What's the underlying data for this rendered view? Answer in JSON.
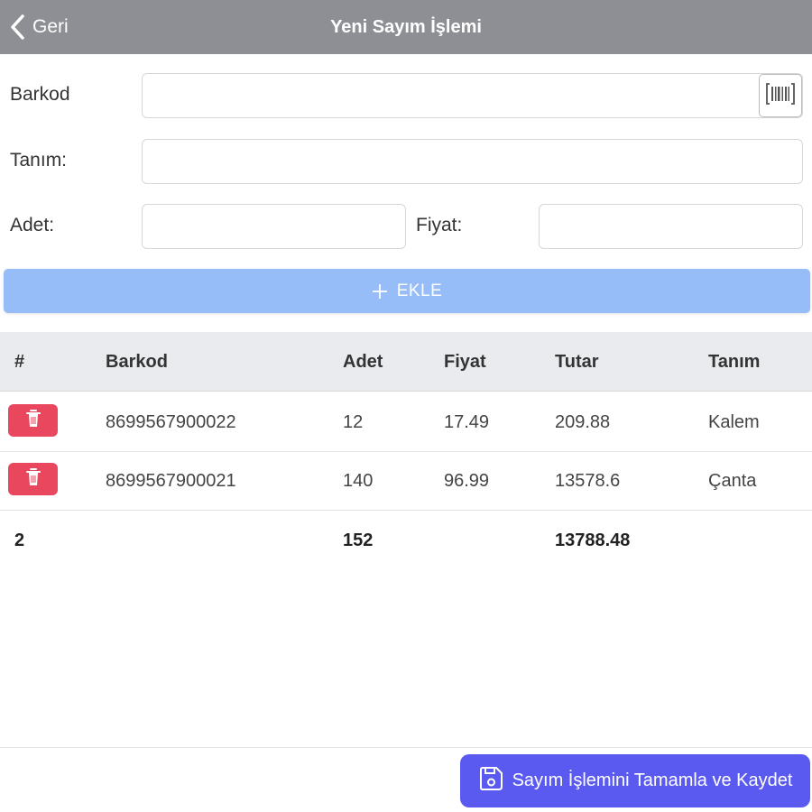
{
  "header": {
    "back_label": "Geri",
    "title": "Yeni Sayım İşlemi",
    "back_icon": "chevron-left-icon"
  },
  "form": {
    "barkod_label": "Barkod",
    "barkod_value": "",
    "scan_icon": "barcode-scan-icon",
    "tanim_label": "Tanım:",
    "tanim_value": "",
    "adet_label": "Adet:",
    "adet_value": "",
    "fiyat_label": "Fiyat:",
    "fiyat_value": "",
    "add_label": "EKLE",
    "add_icon": "plus-icon",
    "add_button_color": "#97bdf8"
  },
  "table": {
    "columns": [
      "#",
      "Barkod",
      "Adet",
      "Fiyat",
      "Tutar",
      "Tanım"
    ],
    "rows": [
      {
        "barkod": "8699567900022",
        "adet": "12",
        "fiyat": "17.49",
        "tutar": "209.88",
        "tanim": "Kalem"
      },
      {
        "barkod": "8699567900021",
        "adet": "140",
        "fiyat": "96.99",
        "tutar": "13578.6",
        "tanim": "Çanta"
      }
    ],
    "footer": {
      "count": "2",
      "total_adet": "152",
      "total_tutar": "13788.48"
    },
    "delete_icon": "trash-icon",
    "delete_color": "#e8475e"
  },
  "actions": {
    "save_label": "Sayım İşlemini Tamamla ve Kaydet",
    "save_icon": "save-icon",
    "save_color": "#5a5af0"
  }
}
